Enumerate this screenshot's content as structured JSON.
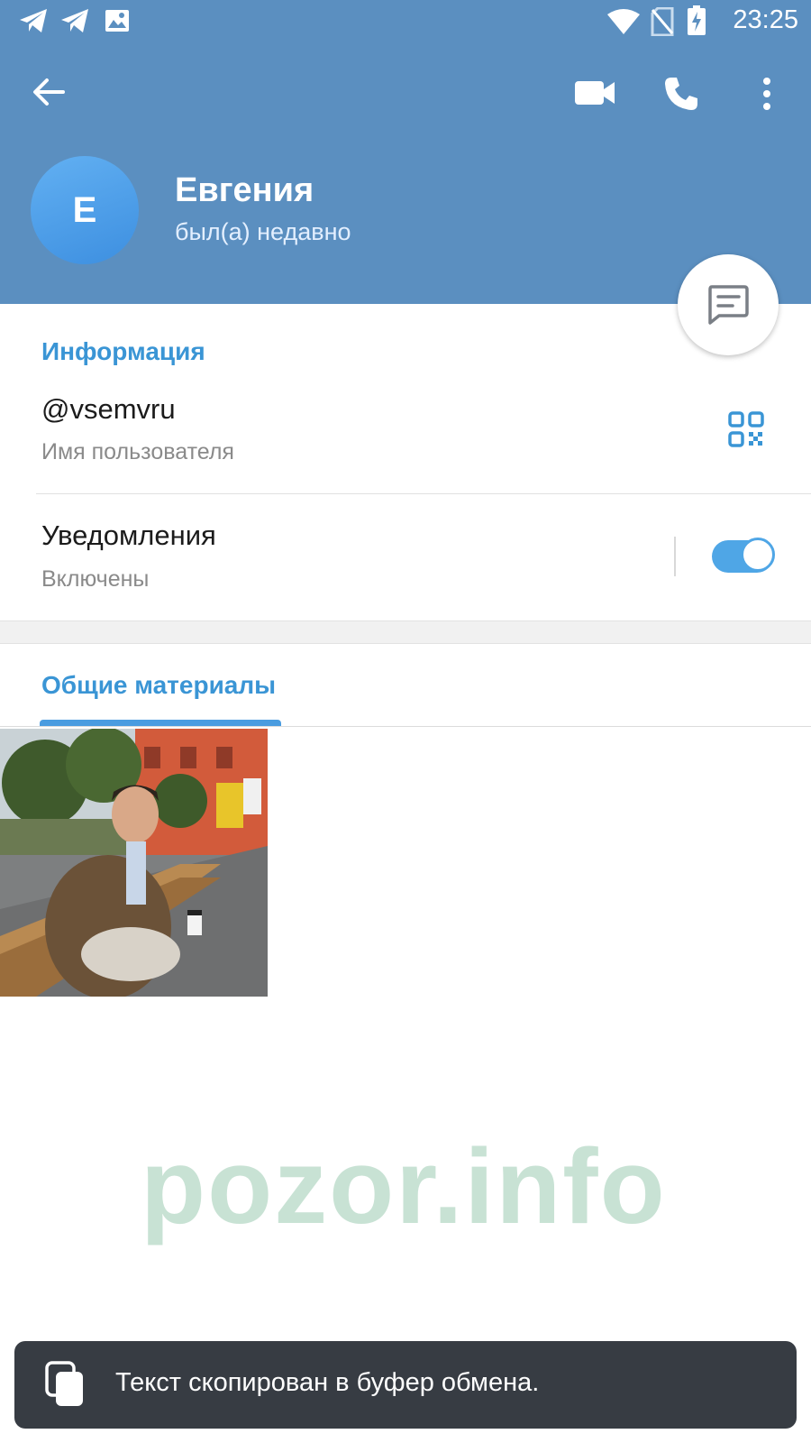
{
  "status_bar": {
    "time": "23:25",
    "left_icons": [
      "telegram-icon",
      "telegram-icon",
      "image-icon"
    ],
    "right_icons": [
      "wifi-icon",
      "no-sim-icon",
      "battery-charging-icon"
    ]
  },
  "toolbar": {
    "back": "arrow-left-icon",
    "video_call": "video-camera-icon",
    "voice_call": "phone-icon",
    "more": "more-vertical-icon"
  },
  "profile": {
    "avatar_letter": "E",
    "name": "Евгения",
    "status": "был(а) недавно"
  },
  "info": {
    "section_title": "Информация",
    "username": "@vsemvru",
    "username_label": "Имя пользователя",
    "notifications": "Уведомления",
    "notifications_state": "Включены",
    "notifications_on": true
  },
  "shared": {
    "section_title": "Общие материалы"
  },
  "watermark": "pozor.info",
  "snackbar": {
    "text": "Текст скопирован в буфер обмена."
  },
  "colors": {
    "header": "#5b8fc0",
    "accent": "#3a95d5",
    "snackbar": "#373c43",
    "watermark": "#c8e2d4"
  }
}
